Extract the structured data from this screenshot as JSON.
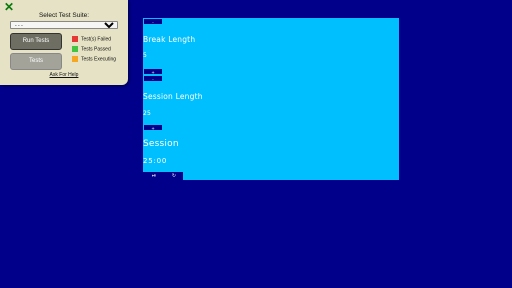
{
  "test_panel": {
    "close_glyph": "✕",
    "title": "Select Test Suite:",
    "selected_suite": "- - -",
    "run_button": "Run Tests",
    "tests_button": "Tests",
    "legend": [
      {
        "label": "Test(s) Failed",
        "color": "#e53935"
      },
      {
        "label": "Tests Passed",
        "color": "#43c443"
      },
      {
        "label": "Tests Executing",
        "color": "#f5a623"
      }
    ],
    "help_link": "Ask For Help"
  },
  "clock": {
    "colors": {
      "background": "#00008b",
      "panel": "#00bfff"
    },
    "break_decrement": "-",
    "break_label": "Break Length",
    "break_value": "5",
    "break_increment": "+",
    "session_decrement": "-",
    "session_length_label": "Session Length",
    "session_length_value": "25",
    "session_increment": "+",
    "session_label": "Session",
    "time_left": "25:00",
    "play_pause_icon": "play-pause-icon",
    "play_pause_glyph": "⏯",
    "reset_icon": "reset-icon",
    "reset_glyph": "↻"
  }
}
